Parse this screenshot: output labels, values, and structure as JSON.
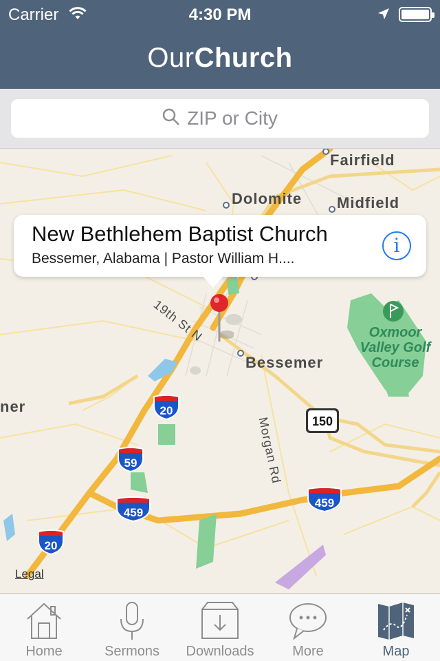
{
  "status_bar": {
    "carrier": "Carrier",
    "time": "4:30 PM"
  },
  "header": {
    "title_light": "Our",
    "title_bold": "Church"
  },
  "search": {
    "placeholder": "ZIP or City"
  },
  "map": {
    "places": [
      "Fairfield",
      "Dolomite",
      "Midfield",
      "Bessemer",
      "ner"
    ],
    "streets": [
      "19th St N",
      "Morgan Rd"
    ],
    "park": {
      "line1": "Oxmoor",
      "line2": "Valley Golf",
      "line3": "Course"
    },
    "shields": [
      "20",
      "59",
      "459",
      "459",
      "20",
      "150"
    ],
    "legal": "Legal"
  },
  "callout": {
    "title": "New Bethlehem Baptist Church",
    "subtitle": "Bessemer, Alabama | Pastor William H....",
    "info_icon": "i"
  },
  "tabs": [
    {
      "label": "Home",
      "icon": "home-icon"
    },
    {
      "label": "Sermons",
      "icon": "microphone-icon"
    },
    {
      "label": "Downloads",
      "icon": "download-icon"
    },
    {
      "label": "More",
      "icon": "chat-bubble-icon"
    },
    {
      "label": "Map",
      "icon": "map-icon",
      "active": true
    }
  ],
  "colors": {
    "header": "#4f647a",
    "accent": "#1e7cf2",
    "road": "#f2b73d",
    "park": "#86cf96"
  }
}
